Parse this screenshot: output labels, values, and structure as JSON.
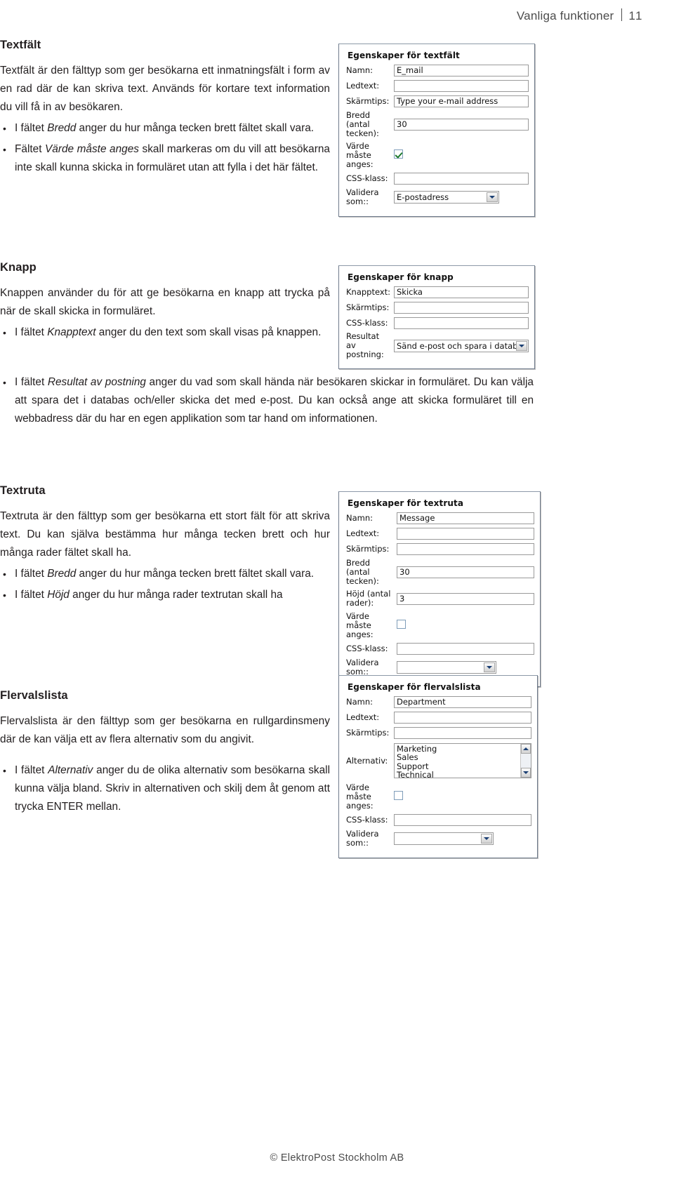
{
  "header": {
    "title": "Vanliga funktioner",
    "page_number": "11"
  },
  "footer": {
    "copyright": "© ElektroPost Stockholm AB"
  },
  "sections": {
    "textfalt": {
      "heading": "Textfält",
      "intro": "Textfält är den fälttyp som ger besökarna ett inmatningsfält i form av en rad där de kan skriva text. Används för kortare text information du vill få in av besökaren.",
      "bullets": [
        {
          "pre": "I fältet ",
          "em": "Bredd",
          "post": " anger du hur många tecken brett fältet skall vara."
        },
        {
          "pre": "Fältet ",
          "em": "Värde måste anges",
          "post": " skall markeras om du vill att besökarna inte skall kunna skicka in formuläret utan att fylla i det här fältet."
        }
      ]
    },
    "knapp": {
      "heading": "Knapp",
      "intro": "Knappen använder du för att ge besökarna en knapp att trycka på när de skall skicka in formuläret.",
      "bullets": [
        {
          "pre": "I fältet ",
          "em": "Knapptext",
          "post": " anger du den text som skall visas på knappen."
        },
        {
          "pre": "I fältet ",
          "em": "Resultat av postning",
          "post": " anger du vad som skall hända när besökaren skickar in formuläret. Du kan välja att spara det i databas och/eller skicka det med e-post. Du kan också ange att skicka formuläret till en webbadress där du har en egen applikation som tar hand om informationen."
        }
      ]
    },
    "textruta": {
      "heading": "Textruta",
      "intro": "Textruta är den fälttyp som ger besökarna ett stort fält för att skriva text. Du kan själva bestämma hur många tecken brett och hur många rader fältet skall ha.",
      "bullets": [
        {
          "pre": "I fältet ",
          "em": "Bredd",
          "post": " anger du hur många tecken brett fältet skall vara."
        },
        {
          "pre": "I fältet ",
          "em": "Höjd",
          "post": " anger du hur många rader textrutan skall ha"
        }
      ]
    },
    "flervalslista": {
      "heading": "Flervalslista",
      "intro": "Flervalslista är den fälttyp som ger besökarna en rullgardinsmeny där de kan välja ett av flera alternativ som du angivit.",
      "bullets": [
        {
          "pre": "I fältet ",
          "em": "Alternativ",
          "post": " anger du de olika alternativ som besökarna skall kunna välja bland. Skriv in alternativen och skilj dem åt genom att trycka ENTER mellan."
        }
      ]
    }
  },
  "dialogs": {
    "textfalt": {
      "title": "Egenskaper för textfält",
      "fields": {
        "namn_label": "Namn:",
        "namn_value": "E_mail",
        "ledtext_label": "Ledtext:",
        "ledtext_value": "",
        "skarmtips_label": "Skärmtips:",
        "skarmtips_value": "Type your e-mail address",
        "bredd_label": "Bredd (antal tecken):",
        "bredd_value": "30",
        "varde_label": "Värde måste anges:",
        "varde_checked": true,
        "css_label": "CSS-klass:",
        "css_value": "",
        "validera_label": "Validera som::",
        "validera_value": "E-postadress"
      }
    },
    "knapp": {
      "title": "Egenskaper för knapp",
      "fields": {
        "knapptext_label": "Knapptext:",
        "knapptext_value": "Skicka",
        "skarmtips_label": "Skärmtips:",
        "skarmtips_value": "",
        "css_label": "CSS-klass:",
        "css_value": "",
        "resultat_label": "Resultat av postning:",
        "resultat_value": "Sänd e-post och spara i databas"
      }
    },
    "textruta": {
      "title": "Egenskaper för textruta",
      "fields": {
        "namn_label": "Namn:",
        "namn_value": "Message",
        "ledtext_label": "Ledtext:",
        "ledtext_value": "",
        "skarmtips_label": "Skärmtips:",
        "skarmtips_value": "",
        "bredd_label": "Bredd (antal tecken):",
        "bredd_value": "30",
        "hojd_label": "Höjd (antal rader):",
        "hojd_value": "3",
        "varde_label": "Värde måste anges:",
        "varde_checked": false,
        "css_label": "CSS-klass:",
        "css_value": "",
        "validera_label": "Validera som::",
        "validera_value": ""
      }
    },
    "flervalslista": {
      "title": "Egenskaper för flervalslista",
      "fields": {
        "namn_label": "Namn:",
        "namn_value": "Department",
        "ledtext_label": "Ledtext:",
        "ledtext_value": "",
        "skarmtips_label": "Skärmtips:",
        "skarmtips_value": "",
        "alternativ_label": "Alternativ:",
        "alternativ_items": [
          "Marketing",
          "Sales",
          "Support",
          "Technical"
        ],
        "varde_label": "Värde måste anges:",
        "varde_checked": false,
        "css_label": "CSS-klass:",
        "css_value": "",
        "validera_label": "Validera som::",
        "validera_value": ""
      }
    }
  },
  "colors": {
    "text": "#231f20",
    "muted": "#4c4c4c",
    "panel_border": "#6f7b8c",
    "field_border": "#9a9a9a",
    "check_green": "#1d7a2e",
    "arrow_blue": "#1b3f73"
  }
}
